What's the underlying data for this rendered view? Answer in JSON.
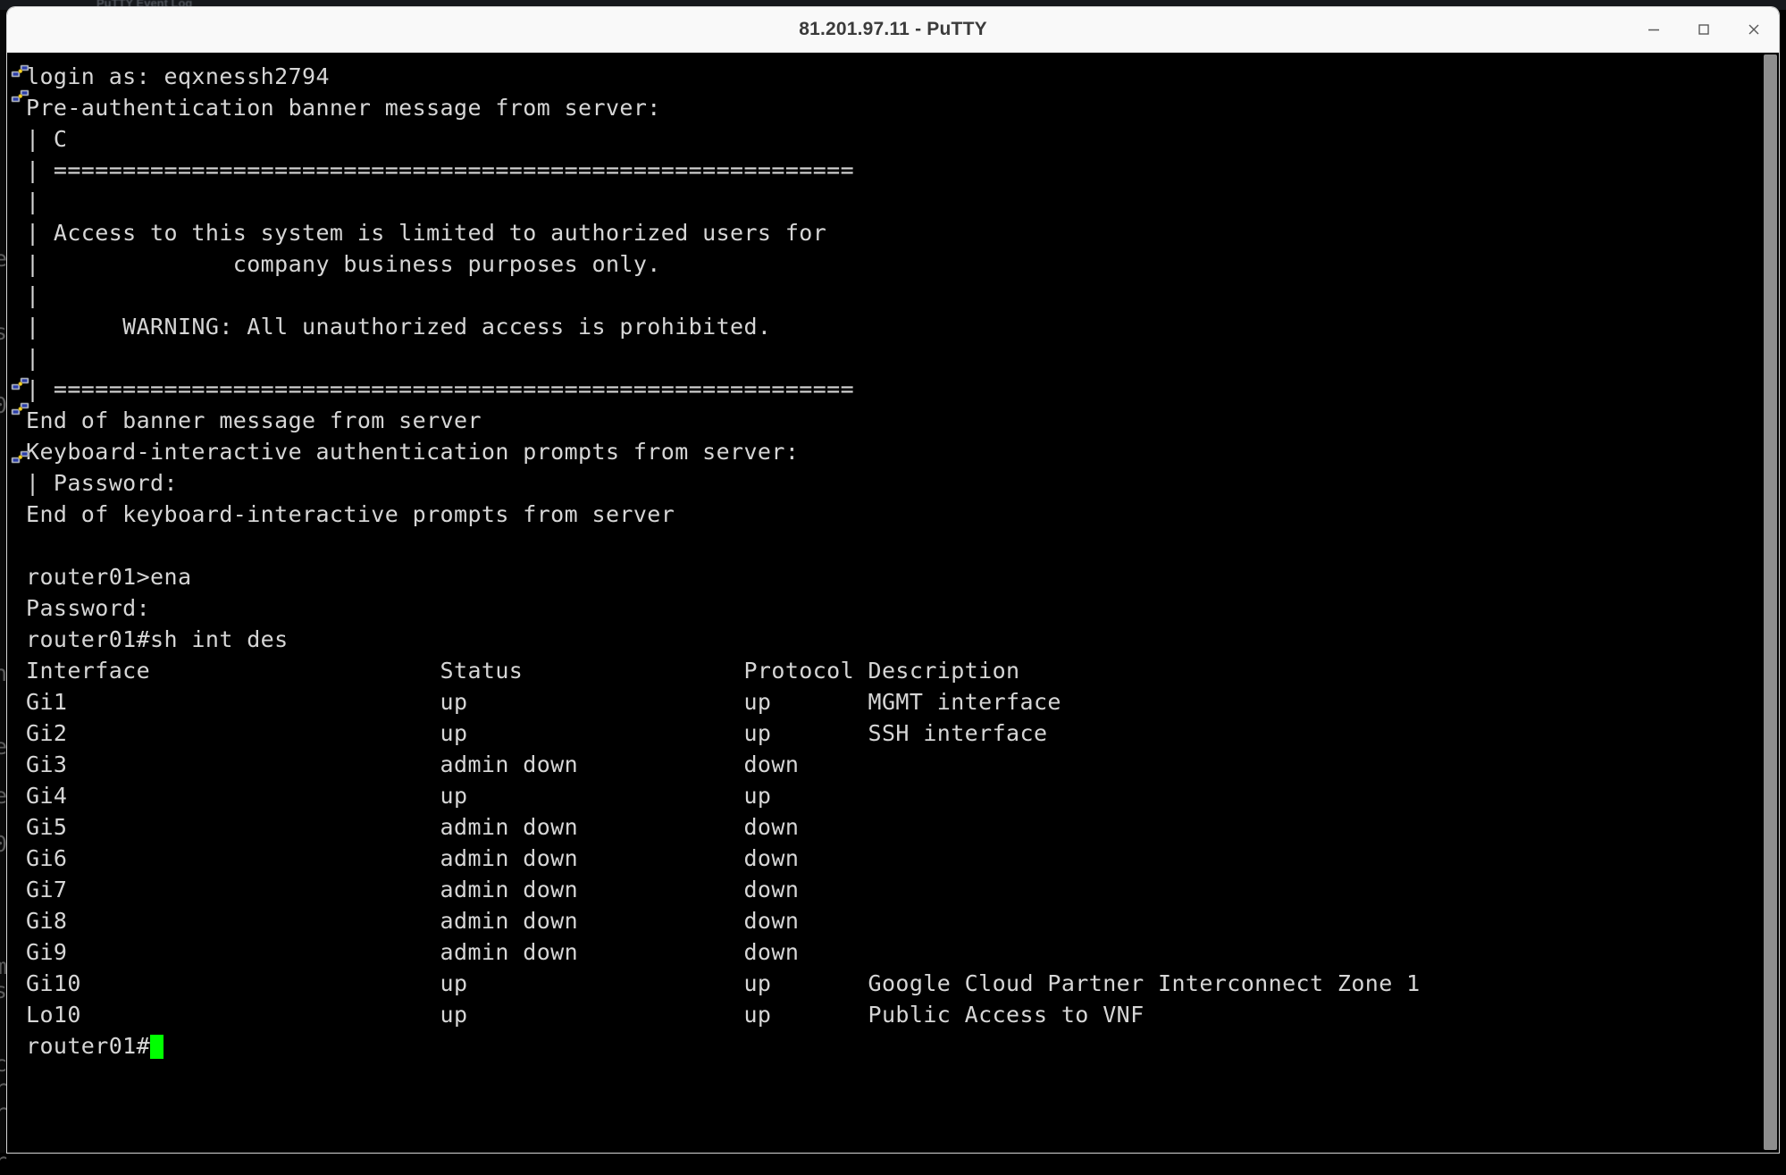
{
  "background_window": {
    "title_fragment": "PuTTY Event Log",
    "left_edge_chars": "\n\n\n\n\n\n\n\n\n\n\n\n\n\n\n\n\n\n\n\n\n\n\n\n\n\n\n\n\n\n\n\n\n\n\n\n\n\n\n\n"
  },
  "window": {
    "title": "81.201.97.11 - PuTTY",
    "controls": {
      "minimize_label": "Minimize",
      "maximize_label": "Maximize",
      "close_label": "Close"
    }
  },
  "terminal": {
    "prompt_final": "router01#",
    "cursor_color": "#00ff00",
    "foreground_color": "#d6d6d6",
    "background_color": "#000000",
    "lines": [
      "login as: eqxnessh2794",
      "Pre-authentication banner message from server:",
      "| C",
      "| ==========================================================",
      "|",
      "| Access to this system is limited to authorized users for",
      "|              company business purposes only.",
      "|",
      "|      WARNING: All unauthorized access is prohibited.",
      "|",
      "| ==========================================================",
      "End of banner message from server",
      "Keyboard-interactive authentication prompts from server:",
      "| Password:",
      "End of keyboard-interactive prompts from server",
      "",
      "router01>ena",
      "Password:",
      "router01#sh int des"
    ],
    "table": {
      "headers": [
        "Interface",
        "Status",
        "Protocol",
        "Description"
      ],
      "rows": [
        {
          "interface": "Gi1",
          "status": "up",
          "protocol": "up",
          "description": "MGMT interface"
        },
        {
          "interface": "Gi2",
          "status": "up",
          "protocol": "up",
          "description": "SSH interface"
        },
        {
          "interface": "Gi3",
          "status": "admin down",
          "protocol": "down",
          "description": ""
        },
        {
          "interface": "Gi4",
          "status": "up",
          "protocol": "up",
          "description": ""
        },
        {
          "interface": "Gi5",
          "status": "admin down",
          "protocol": "down",
          "description": ""
        },
        {
          "interface": "Gi6",
          "status": "admin down",
          "protocol": "down",
          "description": ""
        },
        {
          "interface": "Gi7",
          "status": "admin down",
          "protocol": "down",
          "description": ""
        },
        {
          "interface": "Gi8",
          "status": "admin down",
          "protocol": "down",
          "description": ""
        },
        {
          "interface": "Gi9",
          "status": "admin down",
          "protocol": "down",
          "description": ""
        },
        {
          "interface": "Gi10",
          "status": "up",
          "protocol": "up",
          "description": "Google Cloud Partner Interconnect Zone 1"
        },
        {
          "interface": "Lo10",
          "status": "up",
          "protocol": "up",
          "description": "Public Access to VNF"
        }
      ]
    }
  },
  "scrollbar": {
    "orientation": "vertical",
    "position": "bottom"
  }
}
